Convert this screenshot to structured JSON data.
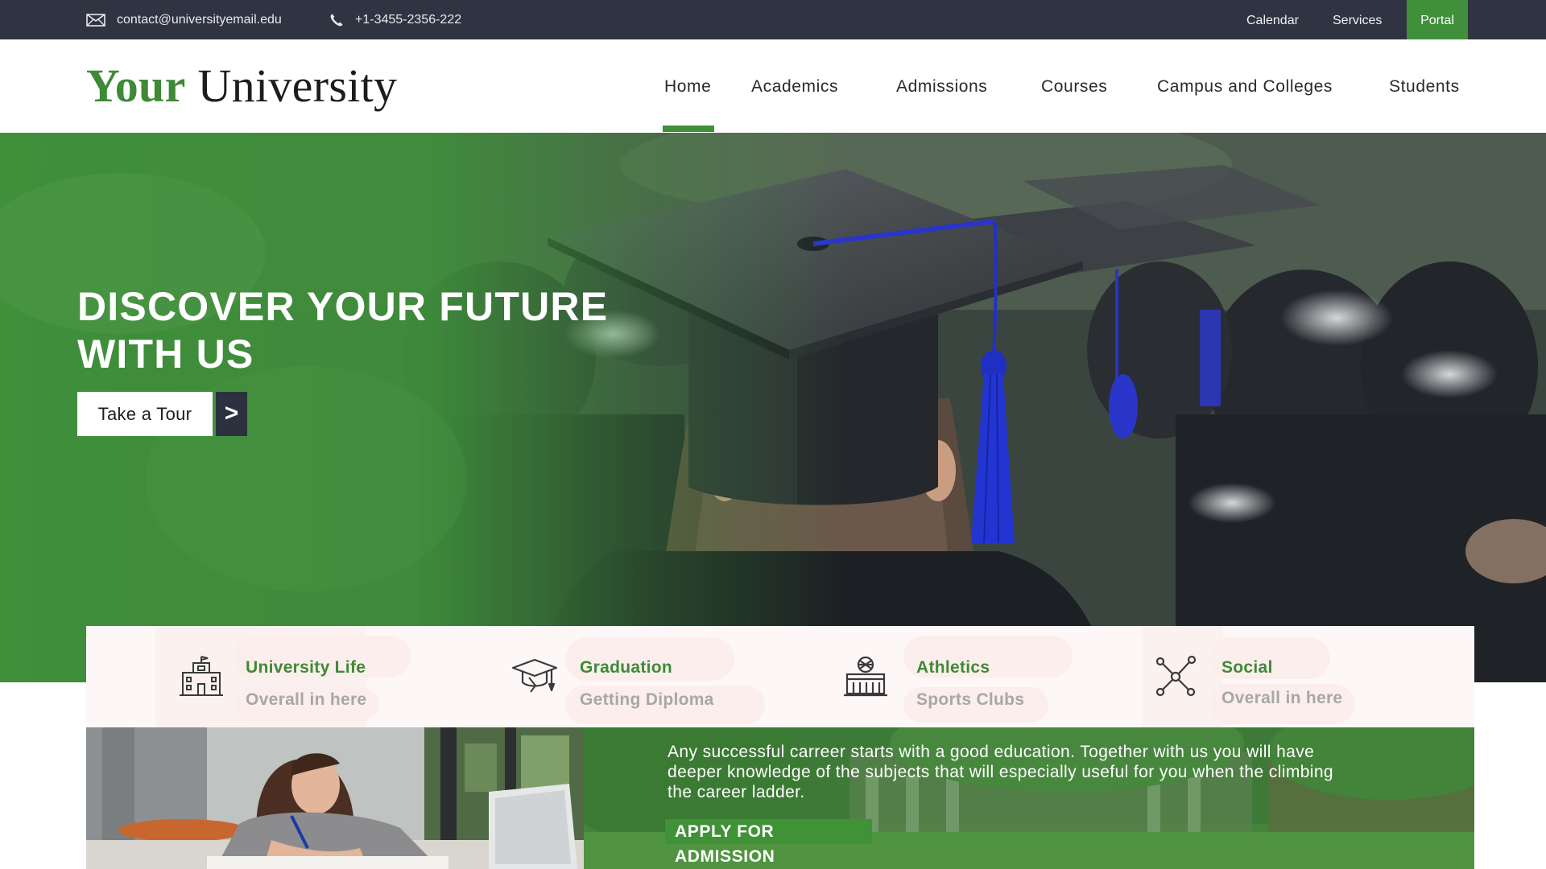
{
  "topbar": {
    "email": "contact@universityemail.edu",
    "phone": "+1-3455-2356-222",
    "links": [
      "Calendar",
      "Services",
      "Portal"
    ]
  },
  "logo": {
    "part1": "Your",
    "part2": "University"
  },
  "nav": {
    "items": [
      "Home",
      "Academics",
      "Admissions",
      "Courses",
      "Campus and Colleges",
      "Students"
    ],
    "active": "Home"
  },
  "hero": {
    "title_line1": "DISCOVER YOUR FUTURE",
    "title_line2": "WITH US",
    "tour_label": "Take a Tour",
    "tour_arrow": ">"
  },
  "features": [
    {
      "icon": "university-building-icon",
      "title": "University Life",
      "subtitle": "Overall in here"
    },
    {
      "icon": "graduation-cap-icon",
      "title": "Graduation",
      "subtitle": "Getting Diploma"
    },
    {
      "icon": "athletics-building-icon",
      "title": "Athletics",
      "subtitle": "Sports Clubs"
    },
    {
      "icon": "social-network-icon",
      "title": "Social",
      "subtitle": "Overall in here"
    }
  ],
  "banner": {
    "text": "Any successful carreer starts with a good education. Together with us you will have deeper knowledge of the subjects that will especially useful for you when the climbing the career ladder.",
    "cta": "APPLY FOR ADMISSION"
  },
  "colors": {
    "brand_green": "#3f8f3b",
    "topbar_dark": "#303442",
    "feature_bg": "#fdf8f7"
  }
}
